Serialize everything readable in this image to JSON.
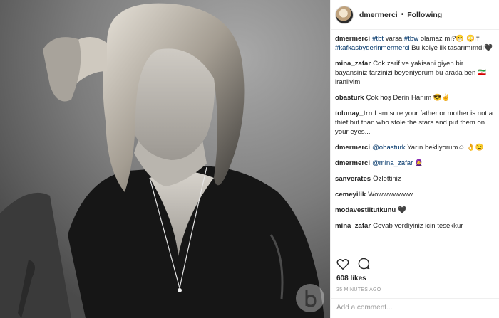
{
  "header": {
    "username": "dmermerci",
    "separator": "•",
    "follow_label": "Following"
  },
  "comments": [
    {
      "user": "dmermerci",
      "parts": [
        {
          "t": "#tbt",
          "tag": true
        },
        {
          "t": " varsa "
        },
        {
          "t": "#tbw",
          "tag": true
        },
        {
          "t": " olamaz mı?😁 😳🇹 "
        },
        {
          "t": "#kafkasbyderinmermerci",
          "tag": true
        },
        {
          "t": " Bu kolye ilk tasarımımdı🖤"
        }
      ]
    },
    {
      "user": "mina_zafar",
      "parts": [
        {
          "t": "Cok zarif ve yakisani giyen bir bayansiniz tarzinizi beyeniyorum bu arada ben 🇮🇷 iranliyim"
        }
      ]
    },
    {
      "user": "obasturk",
      "parts": [
        {
          "t": "Çok hoş Derin Hanım 😎✌"
        }
      ]
    },
    {
      "user": "tolunay_trn",
      "parts": [
        {
          "t": "I am sure your father or mother is not a thief,but than who stole the stars and put them on your eyes..."
        }
      ]
    },
    {
      "user": "dmermerci",
      "parts": [
        {
          "t": "@obasturk",
          "tag": true
        },
        {
          "t": " Yarın bekliyorum☺ 👌😉"
        }
      ]
    },
    {
      "user": "dmermerci",
      "parts": [
        {
          "t": "@mina_zafar",
          "tag": true
        },
        {
          "t": " 🧕"
        }
      ]
    },
    {
      "user": "sanverates",
      "parts": [
        {
          "t": "Özlettiniz"
        }
      ]
    },
    {
      "user": "cemeyilik",
      "parts": [
        {
          "t": "Wowwwwwww"
        }
      ]
    },
    {
      "user": "modavestiltutkunu",
      "parts": [
        {
          "t": "🖤"
        }
      ]
    },
    {
      "user": "mina_zafar",
      "parts": [
        {
          "t": "Cevab verdiyiniz icin tesekkur"
        }
      ],
      "cut": true
    }
  ],
  "icons": [
    "heart-icon",
    "comment-icon"
  ],
  "likes": "608 likes",
  "timestamp": "35 MINUTES AGO",
  "comment_box": {
    "placeholder": "Add a comment..."
  }
}
